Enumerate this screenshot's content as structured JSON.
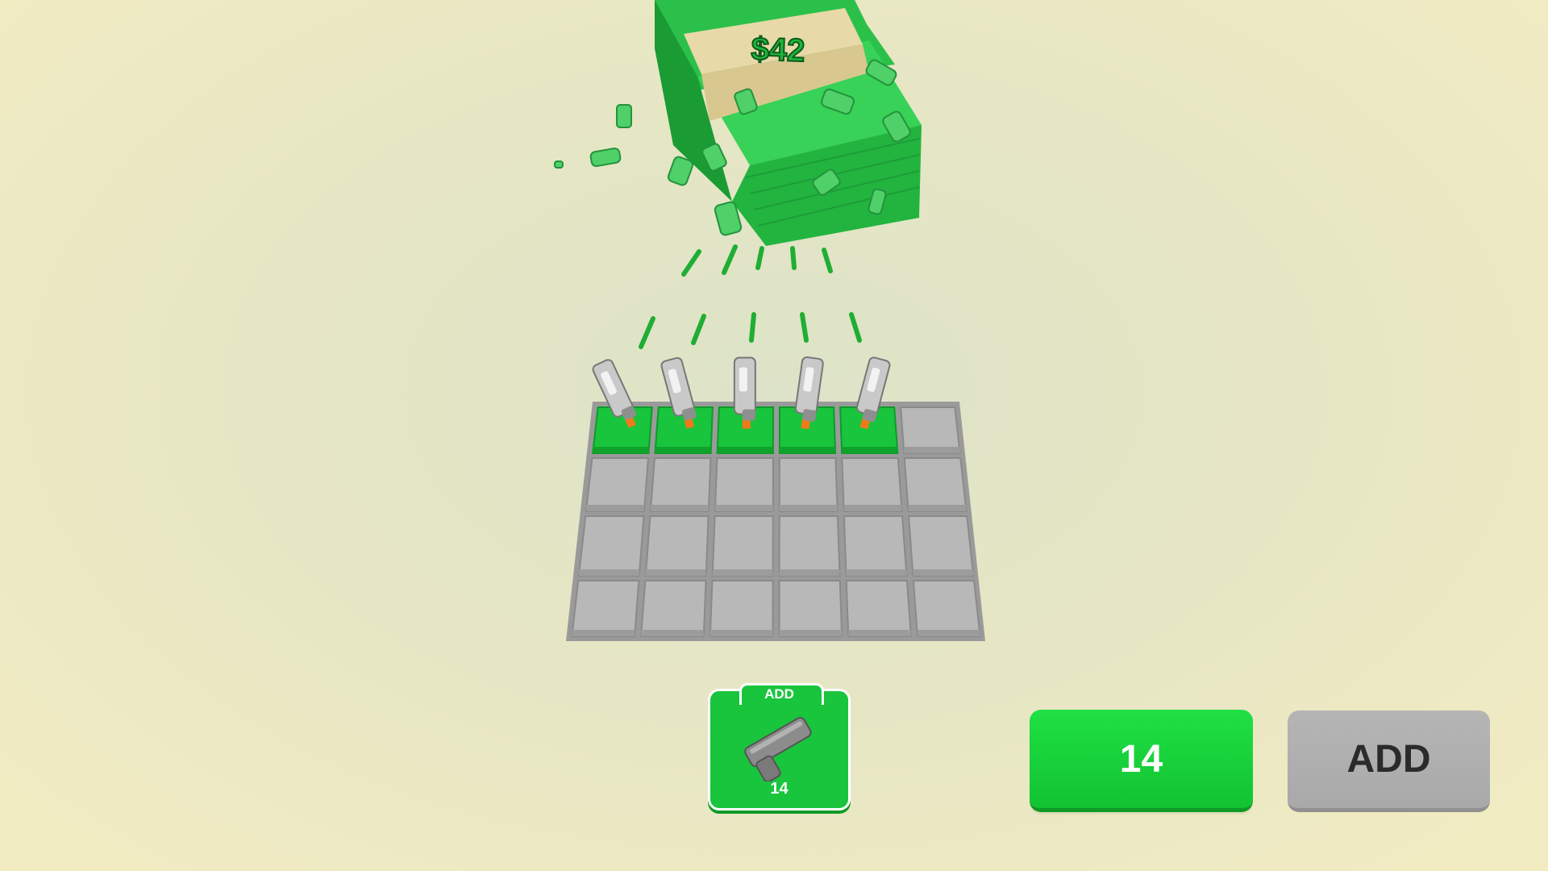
{
  "hud": {
    "money_stack_value": "$42"
  },
  "add_card": {
    "title": "ADD",
    "count": "14",
    "icon": "pistol-icon"
  },
  "buttons": {
    "price_label": "14",
    "add_label": "ADD"
  },
  "grid": {
    "rows": 4,
    "columns": 6,
    "occupied_row1_slots": 5
  },
  "colors": {
    "green": "#18c53d",
    "grey": "#a9a9a9",
    "bullet_green": "#1fae33",
    "tile_grey": "#b8b8b8"
  }
}
